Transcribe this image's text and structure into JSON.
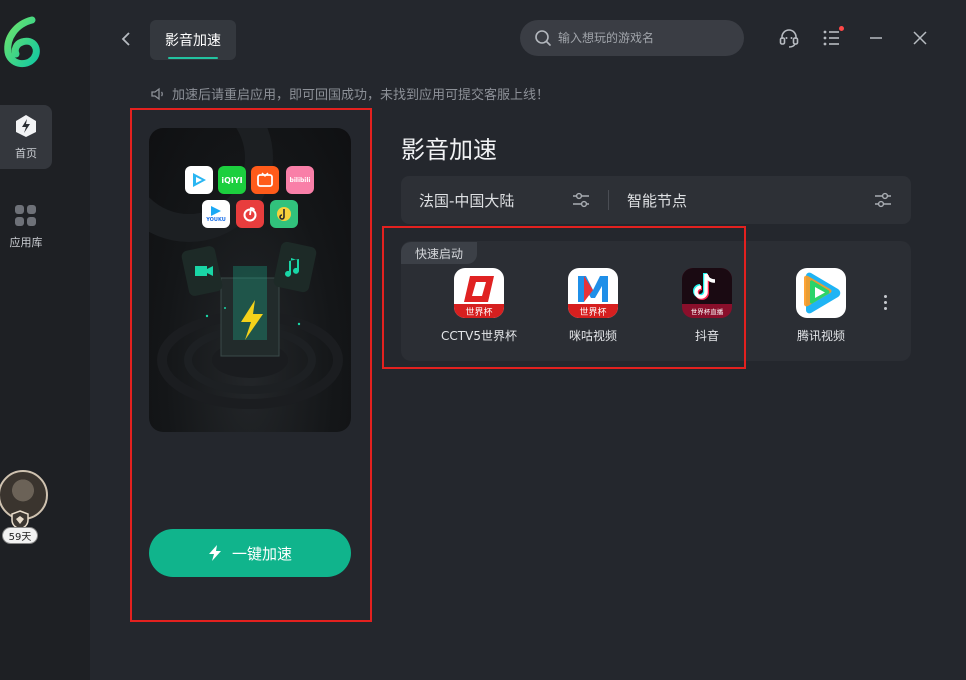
{
  "sidebar": {
    "items": [
      {
        "label": "首页",
        "icon": "lightning-home-icon",
        "active": true
      },
      {
        "label": "应用库",
        "icon": "apps-grid-icon",
        "active": false
      }
    ],
    "user": {
      "days_badge": "59天"
    }
  },
  "header": {
    "tab_label": "影音加速",
    "search_placeholder": "输入想玩的游戏名"
  },
  "notice": "加速后请重启应用，即可回国成功，未找到应用可提交客服上线！",
  "left_card": {
    "accelerate_label": "一键加速",
    "mini_apps": [
      "tencent-video-icon",
      "iqiyi-icon",
      "mango-tv-icon",
      "bilibili-icon",
      "youku-icon",
      "netease-music-icon",
      "qq-music-icon"
    ],
    "iqiyi_text": "iQIYI",
    "youku_text": "YOUKU",
    "bilibili_text": "bilibili"
  },
  "main": {
    "title": "影音加速",
    "region": "法国-中国大陆",
    "node": "智能节点",
    "quick_start_tag": "快速启动",
    "quick_apps": [
      {
        "name": "CCTV5世界杯",
        "badge": "世界杯"
      },
      {
        "name": "咪咕视频",
        "badge": "世界杯"
      },
      {
        "name": "抖音",
        "badge": "世界杯直播"
      },
      {
        "name": "腾讯视频",
        "badge": ""
      }
    ]
  },
  "colors": {
    "accent": "#10b48c",
    "highlight_box": "#e3211f",
    "background": "#24272d",
    "sidebar": "#1e2024"
  }
}
